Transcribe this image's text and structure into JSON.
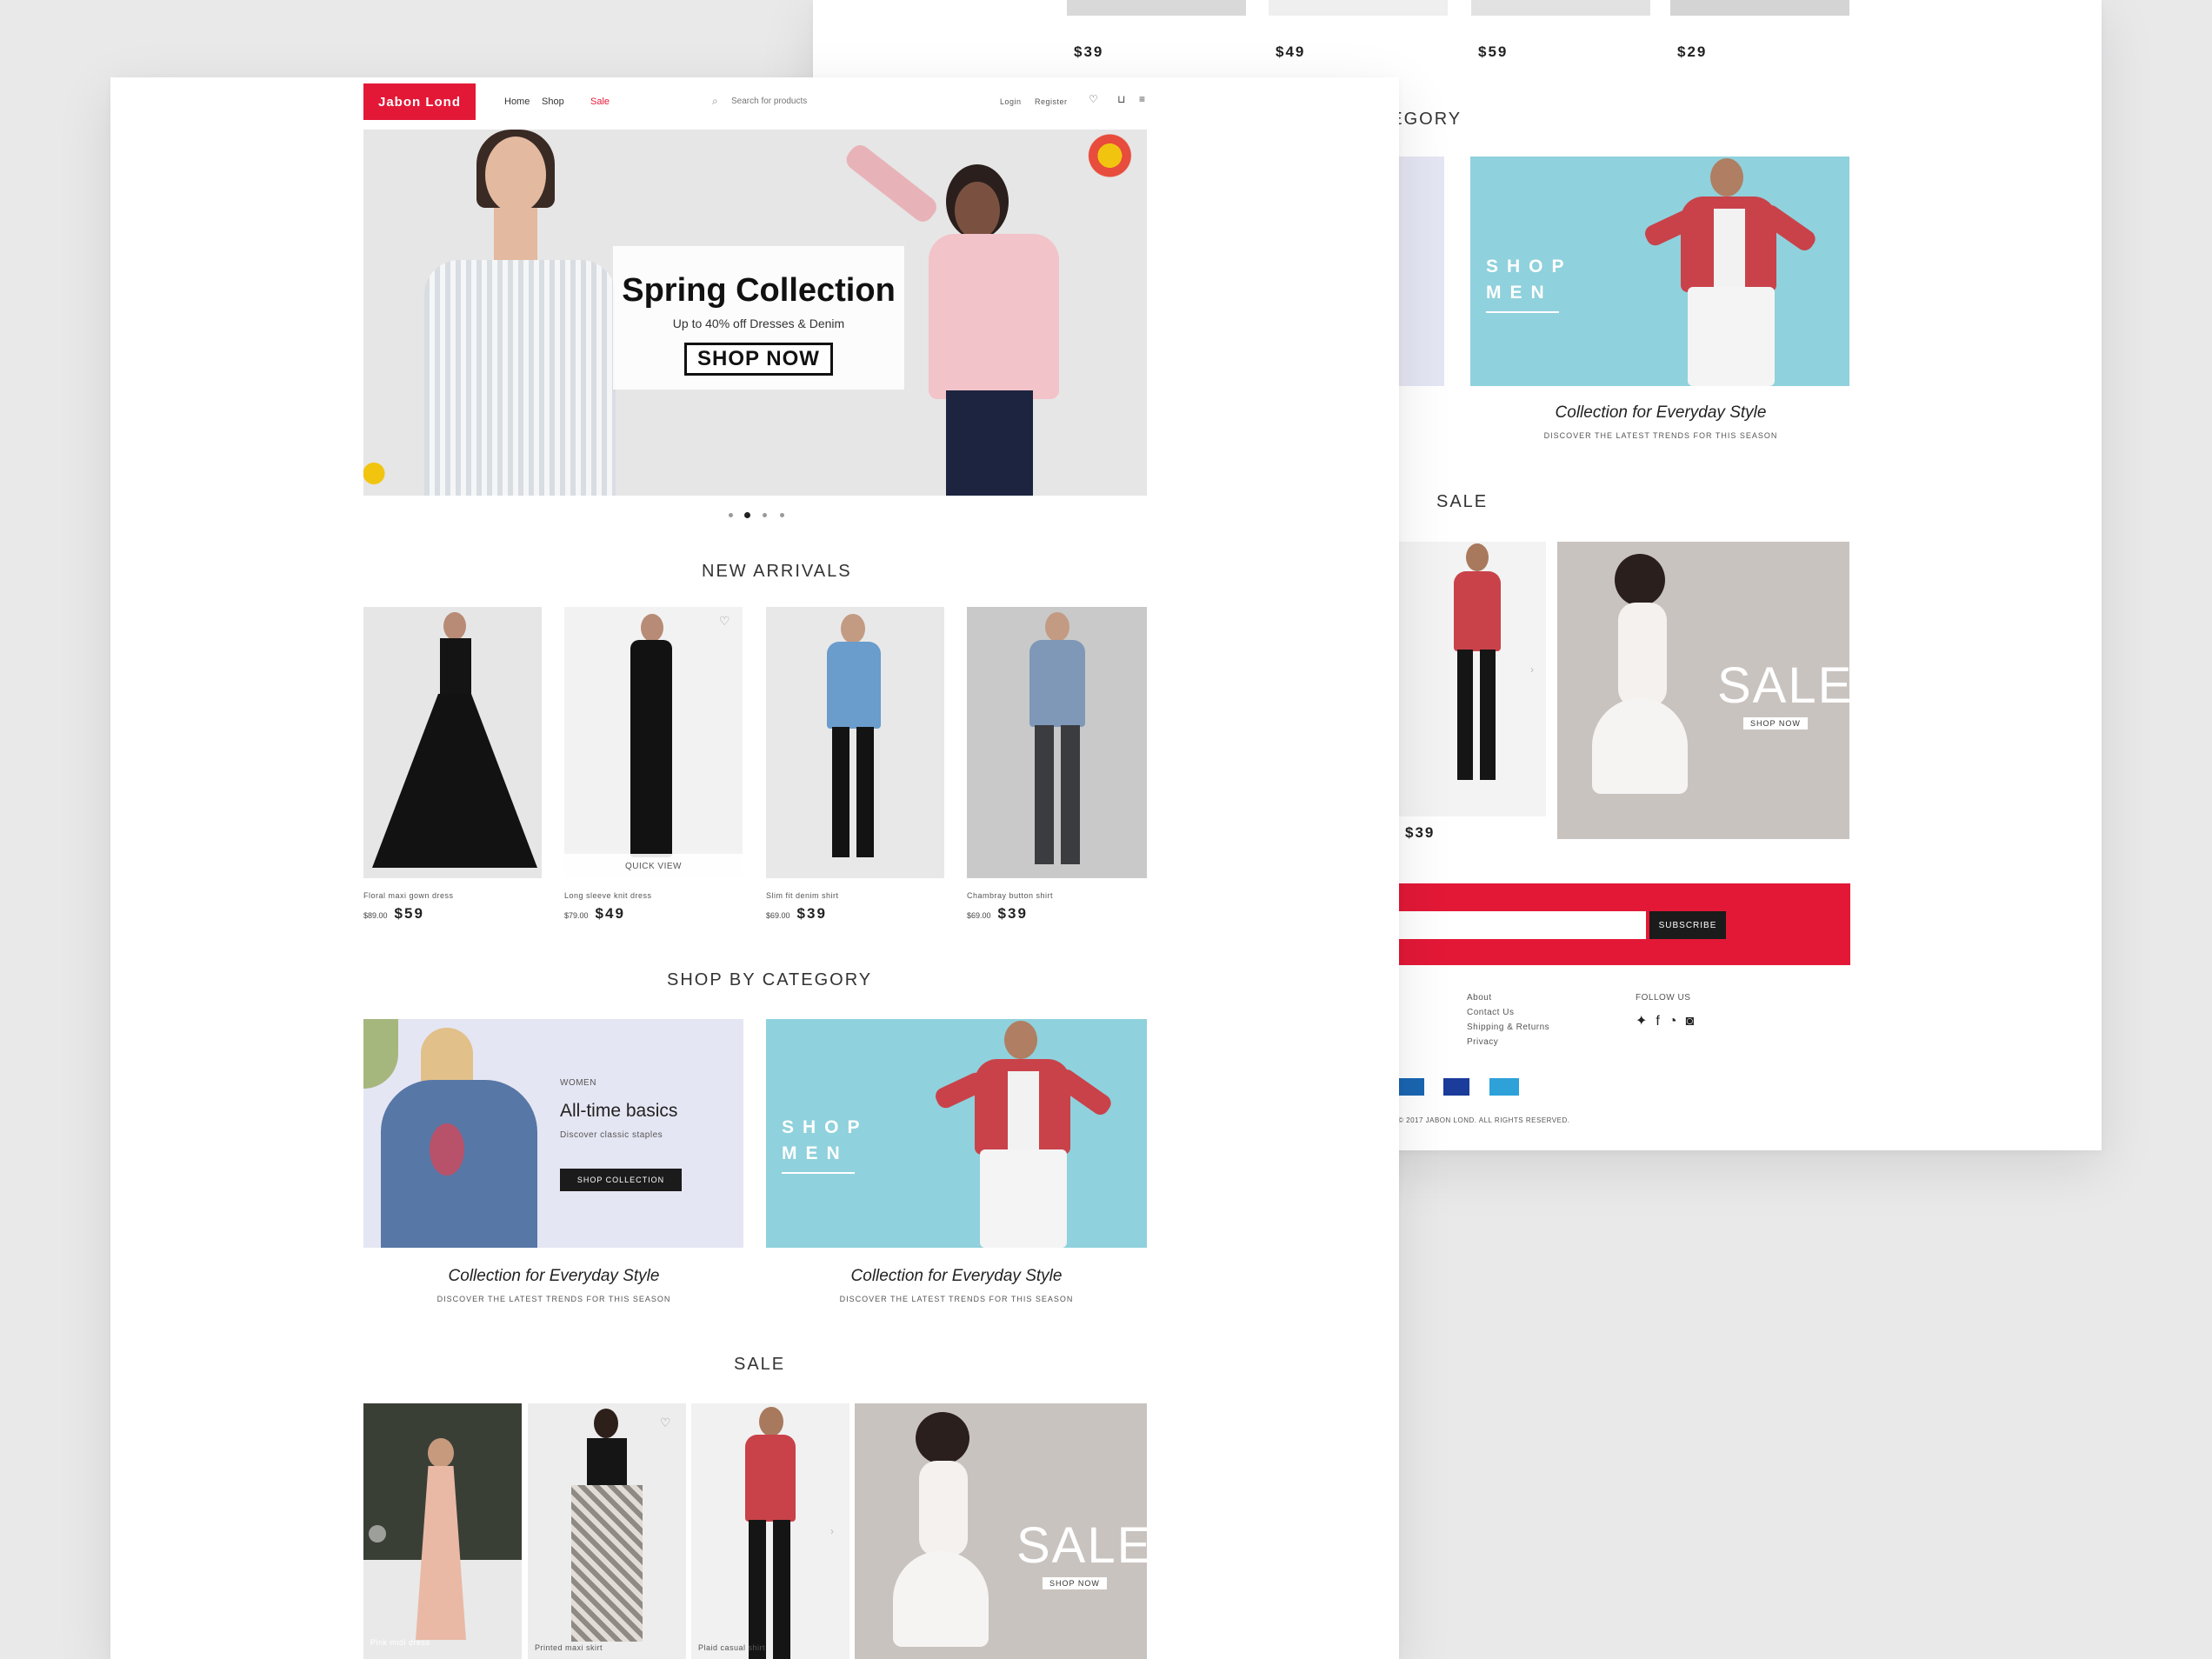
{
  "header": {
    "logo": "Jabon Lond",
    "nav": [
      "Home",
      "Shop",
      "Sale"
    ],
    "search_placeholder": "Search for products",
    "account_links": [
      "Login",
      "Register"
    ]
  },
  "hero": {
    "title": "Spring Collection",
    "subtitle": "Up to 40% off Dresses & Denim",
    "button": "SHOP NOW"
  },
  "sections": {
    "products_title": "NEW ARRIVALS",
    "category_title": "SHOP BY CATEGORY",
    "sale_title": "SALE"
  },
  "products": [
    {
      "name": "Floral maxi gown dress",
      "old_price": "$89.00",
      "price": "$59"
    },
    {
      "name": "Long sleeve knit dress",
      "old_price": "$79.00",
      "price": "$49",
      "badge": "QUICK VIEW"
    },
    {
      "name": "Slim fit denim shirt",
      "old_price": "$69.00",
      "price": "$39"
    },
    {
      "name": "Chambray button shirt",
      "old_price": "$69.00",
      "price": "$39"
    }
  ],
  "categories": [
    {
      "eyebrow": "WOMEN",
      "title": "All-time basics",
      "desc": "Discover classic staples",
      "button": "SHOP COLLECTION",
      "caption": "Collection for Everyday Style",
      "link": "DISCOVER THE LATEST TRENDS FOR THIS SEASON"
    },
    {
      "title": "SHOP MEN",
      "caption": "Collection for Everyday Style",
      "link": "DISCOVER THE LATEST TRENDS FOR THIS SEASON"
    }
  ],
  "sale": {
    "label": "SALE",
    "button": "SHOP NOW",
    "items": [
      "Pink midi dress",
      "Printed maxi skirt",
      "Plaid casual shirt"
    ]
  },
  "back": {
    "prices": [
      "$39",
      "$49",
      "$59",
      "$29"
    ],
    "category_title": "SHOP BY CATEGORY",
    "sale_title": "SALE",
    "shop_men": "SHOP MEN",
    "caption": "Collection for Everyday Style",
    "link": "DISCOVER THE LATEST TRENDS FOR THIS SEASON",
    "sale_label": "SALE",
    "sale_button": "SHOP NOW",
    "product_price": "$39",
    "newsletter_button": "SUBSCRIBE",
    "footer_links": [
      "About",
      "Contact Us",
      "Shipping & Returns",
      "Privacy"
    ],
    "follow_label": "FOLLOW US",
    "copyright": "© 2017 JABON LOND. ALL RIGHTS RESERVED."
  },
  "colors": {
    "brand_red": "#e31837",
    "hero_bg": "#e6e6e6",
    "men_bg": "#8fd1dc",
    "women_bg": "#e5e6f3",
    "sale_bg": "#c9c3bf"
  }
}
